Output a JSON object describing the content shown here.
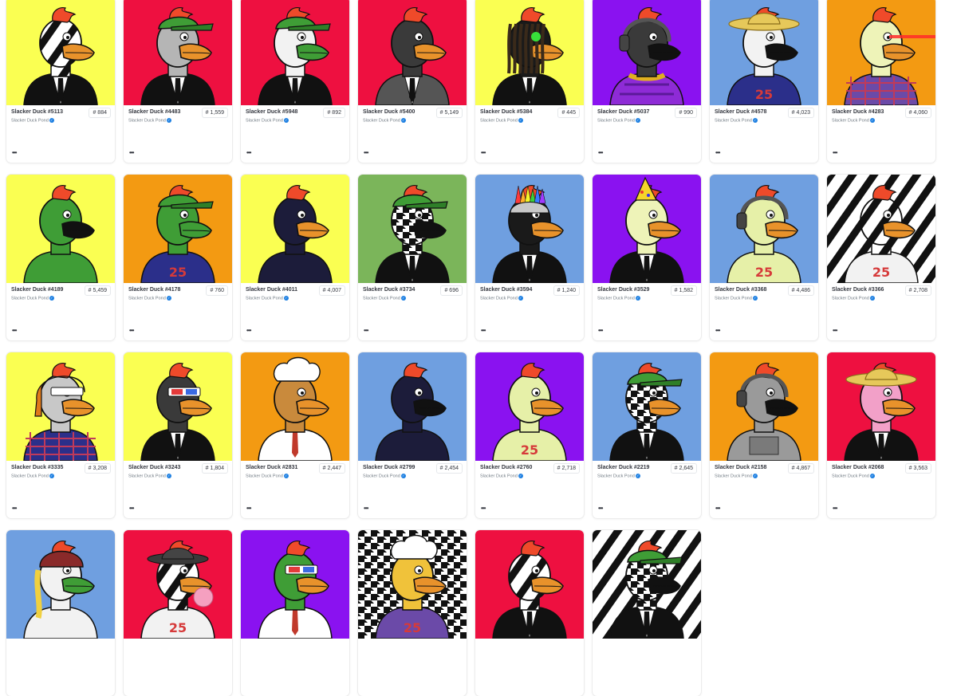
{
  "collection_label": "Slacker Duck Pond",
  "more_label": "•••",
  "icons": {
    "verified": "verified-badge-icon",
    "more": "more-options-icon"
  },
  "items": [
    {
      "name": "Slacker Duck #5113",
      "rank": "# 884",
      "bg": "#faff52",
      "pattern": "",
      "body": "#111111",
      "head": "zebra",
      "bill": "#e8922b",
      "hat": "none",
      "shirt": "suit"
    },
    {
      "name": "Slacker Duck #4483",
      "rank": "# 1,559",
      "bg": "#ee1040",
      "pattern": "",
      "body": "#111111",
      "head": "#b5b5b5",
      "bill": "#e8922b",
      "hat": "green-cap",
      "shirt": "suit"
    },
    {
      "name": "Slacker Duck #5948",
      "rank": "# 892",
      "bg": "#ee1040",
      "pattern": "",
      "body": "#111111",
      "head": "#f2f2f2",
      "bill": "#3f9d36",
      "hat": "green-cap",
      "shirt": "suit"
    },
    {
      "name": "Slacker Duck #5400",
      "rank": "# 5,149",
      "bg": "#ee1040",
      "pattern": "",
      "body": "#555555",
      "head": "#3a3a3a",
      "bill": "#e8922b",
      "hat": "none",
      "shirt": "jacket"
    },
    {
      "name": "Slacker Duck #5384",
      "rank": "# 445",
      "bg": "#faff52",
      "pattern": "",
      "body": "#111111",
      "head": "#1a1a1a",
      "bill": "#e8922b",
      "hat": "dreads",
      "shirt": "suit"
    },
    {
      "name": "Slacker Duck #5037",
      "rank": "# 990",
      "bg": "#8a12f0",
      "pattern": "",
      "body": "#8e2bd6",
      "head": "#3a3a3a",
      "bill": "#111111",
      "hat": "headphones",
      "shirt": "puffer"
    },
    {
      "name": "Slacker Duck #4578",
      "rank": "# 4,023",
      "bg": "#6f9fe0",
      "pattern": "",
      "body": "#2b2f8a",
      "head": "#f2f2f2",
      "bill": "#111111",
      "hat": "straw",
      "shirt": "jersey"
    },
    {
      "name": "Slacker Duck #4283",
      "rank": "# 4,060",
      "bg": "#f39a12",
      "pattern": "",
      "body": "#6b4aa8",
      "head": "#eef3b8",
      "bill": "#e8922b",
      "hat": "laser",
      "shirt": "plaid"
    },
    {
      "name": "Slacker Duck #4189",
      "rank": "# 5,459",
      "bg": "#faff52",
      "pattern": "",
      "body": "#3f9d36",
      "head": "#3f9d36",
      "bill": "#111111",
      "hat": "none",
      "shirt": "bare"
    },
    {
      "name": "Slacker Duck #4178",
      "rank": "# 760",
      "bg": "#f39a12",
      "pattern": "",
      "body": "#2b2f8a",
      "head": "#3f9d36",
      "bill": "#3f9d36",
      "hat": "green-cap",
      "shirt": "jersey"
    },
    {
      "name": "Slacker Duck #4011",
      "rank": "# 4,007",
      "bg": "#faff52",
      "pattern": "",
      "body": "#1c1c3a",
      "head": "#1c1c3a",
      "bill": "#e8922b",
      "hat": "none",
      "shirt": "bare"
    },
    {
      "name": "Slacker Duck #3734",
      "rank": "# 696",
      "bg": "#7bb55a",
      "pattern": "",
      "body": "#111111",
      "head": "houndstooth",
      "bill": "#111111",
      "hat": "green-cap",
      "shirt": "suit"
    },
    {
      "name": "Slacker Duck #3594",
      "rank": "# 1,240",
      "bg": "#6f9fe0",
      "pattern": "",
      "body": "#111111",
      "head": "#1a1a1a",
      "bill": "#e8922b",
      "hat": "mohawk",
      "shirt": "suit"
    },
    {
      "name": "Slacker Duck #3529",
      "rank": "# 1,582",
      "bg": "#8a12f0",
      "pattern": "",
      "body": "#111111",
      "head": "#eef3b8",
      "bill": "#e8922b",
      "hat": "party",
      "shirt": "suit"
    },
    {
      "name": "Slacker Duck #3368",
      "rank": "# 4,486",
      "bg": "#6f9fe0",
      "pattern": "",
      "body": "#e6f0a8",
      "head": "#e6f0a8",
      "bill": "#e8922b",
      "hat": "headphones",
      "shirt": "jersey"
    },
    {
      "name": "Slacker Duck #3366",
      "rank": "# 2,708",
      "bg": "#ffffff",
      "pattern": "zebra",
      "body": "#f2f2f2",
      "head": "zebra",
      "bill": "#e8922b",
      "hat": "none",
      "shirt": "jersey"
    },
    {
      "name": "Slacker Duck #3335",
      "rank": "# 3,208",
      "bg": "#faff52",
      "pattern": "",
      "body": "#2b2f8a",
      "head": "#c8c8c8",
      "bill": "#e8922b",
      "hat": "trapper",
      "shirt": "plaid"
    },
    {
      "name": "Slacker Duck #3243",
      "rank": "# 1,804",
      "bg": "#faff52",
      "pattern": "",
      "body": "#111111",
      "head": "#3a3a3a",
      "bill": "#e8922b",
      "hat": "3d",
      "shirt": "suit"
    },
    {
      "name": "Slacker Duck #2831",
      "rank": "# 2,447",
      "bg": "#f39a12",
      "pattern": "",
      "body": "#ffffff",
      "head": "#c98a3c",
      "bill": "#e8922b",
      "hat": "chef",
      "shirt": "shirt"
    },
    {
      "name": "Slacker Duck #2799",
      "rank": "# 2,454",
      "bg": "#6f9fe0",
      "pattern": "",
      "body": "#1c1c3a",
      "head": "#1c1c3a",
      "bill": "#111111",
      "hat": "none",
      "shirt": "bare"
    },
    {
      "name": "Slacker Duck #2760",
      "rank": "# 2,718",
      "bg": "#8a12f0",
      "pattern": "",
      "body": "#e6f0a8",
      "head": "#e6f0a8",
      "bill": "#e8922b",
      "hat": "none",
      "shirt": "jersey"
    },
    {
      "name": "Slacker Duck #2219",
      "rank": "# 2,645",
      "bg": "#6f9fe0",
      "pattern": "",
      "body": "#111111",
      "head": "houndstooth",
      "bill": "#e8922b",
      "hat": "green-cap",
      "shirt": "suit"
    },
    {
      "name": "Slacker Duck #2158",
      "rank": "# 4,867",
      "bg": "#f39a12",
      "pattern": "",
      "body": "#9a9a9a",
      "head": "#9a9a9a",
      "bill": "#111111",
      "hat": "headphones",
      "shirt": "robot"
    },
    {
      "name": "Slacker Duck #2068",
      "rank": "# 3,563",
      "bg": "#ee1040",
      "pattern": "",
      "body": "#111111",
      "head": "#f2a0c8",
      "bill": "#e8922b",
      "hat": "straw",
      "shirt": "suit"
    },
    {
      "name": "",
      "rank": "",
      "bg": "#6f9fe0",
      "pattern": "",
      "body": "#f2f2f2",
      "head": "#f2f2f2",
      "bill": "#3f9d36",
      "hat": "beanie",
      "shirt": "bare"
    },
    {
      "name": "",
      "rank": "",
      "bg": "#ee1040",
      "pattern": "",
      "body": "#f2f2f2",
      "head": "zebra",
      "bill": "#e8922b",
      "hat": "fedora",
      "shirt": "jersey"
    },
    {
      "name": "",
      "rank": "",
      "bg": "#8a12f0",
      "pattern": "",
      "body": "#ffffff",
      "head": "#3f9d36",
      "bill": "#e8922b",
      "hat": "3d",
      "shirt": "shirt"
    },
    {
      "name": "",
      "rank": "",
      "bg": "#ffffff",
      "pattern": "houndstooth",
      "body": "#6b4aa8",
      "head": "#f0c23a",
      "bill": "#e8922b",
      "hat": "chef",
      "shirt": "jersey"
    },
    {
      "name": "",
      "rank": "",
      "bg": "#ee1040",
      "pattern": "",
      "body": "#111111",
      "head": "zebra",
      "bill": "#e8922b",
      "hat": "none",
      "shirt": "suit"
    },
    {
      "name": "",
      "rank": "",
      "bg": "#ffffff",
      "pattern": "zebra",
      "body": "#111111",
      "head": "houndstooth",
      "bill": "#111111",
      "hat": "green-cap",
      "shirt": "suit"
    }
  ]
}
